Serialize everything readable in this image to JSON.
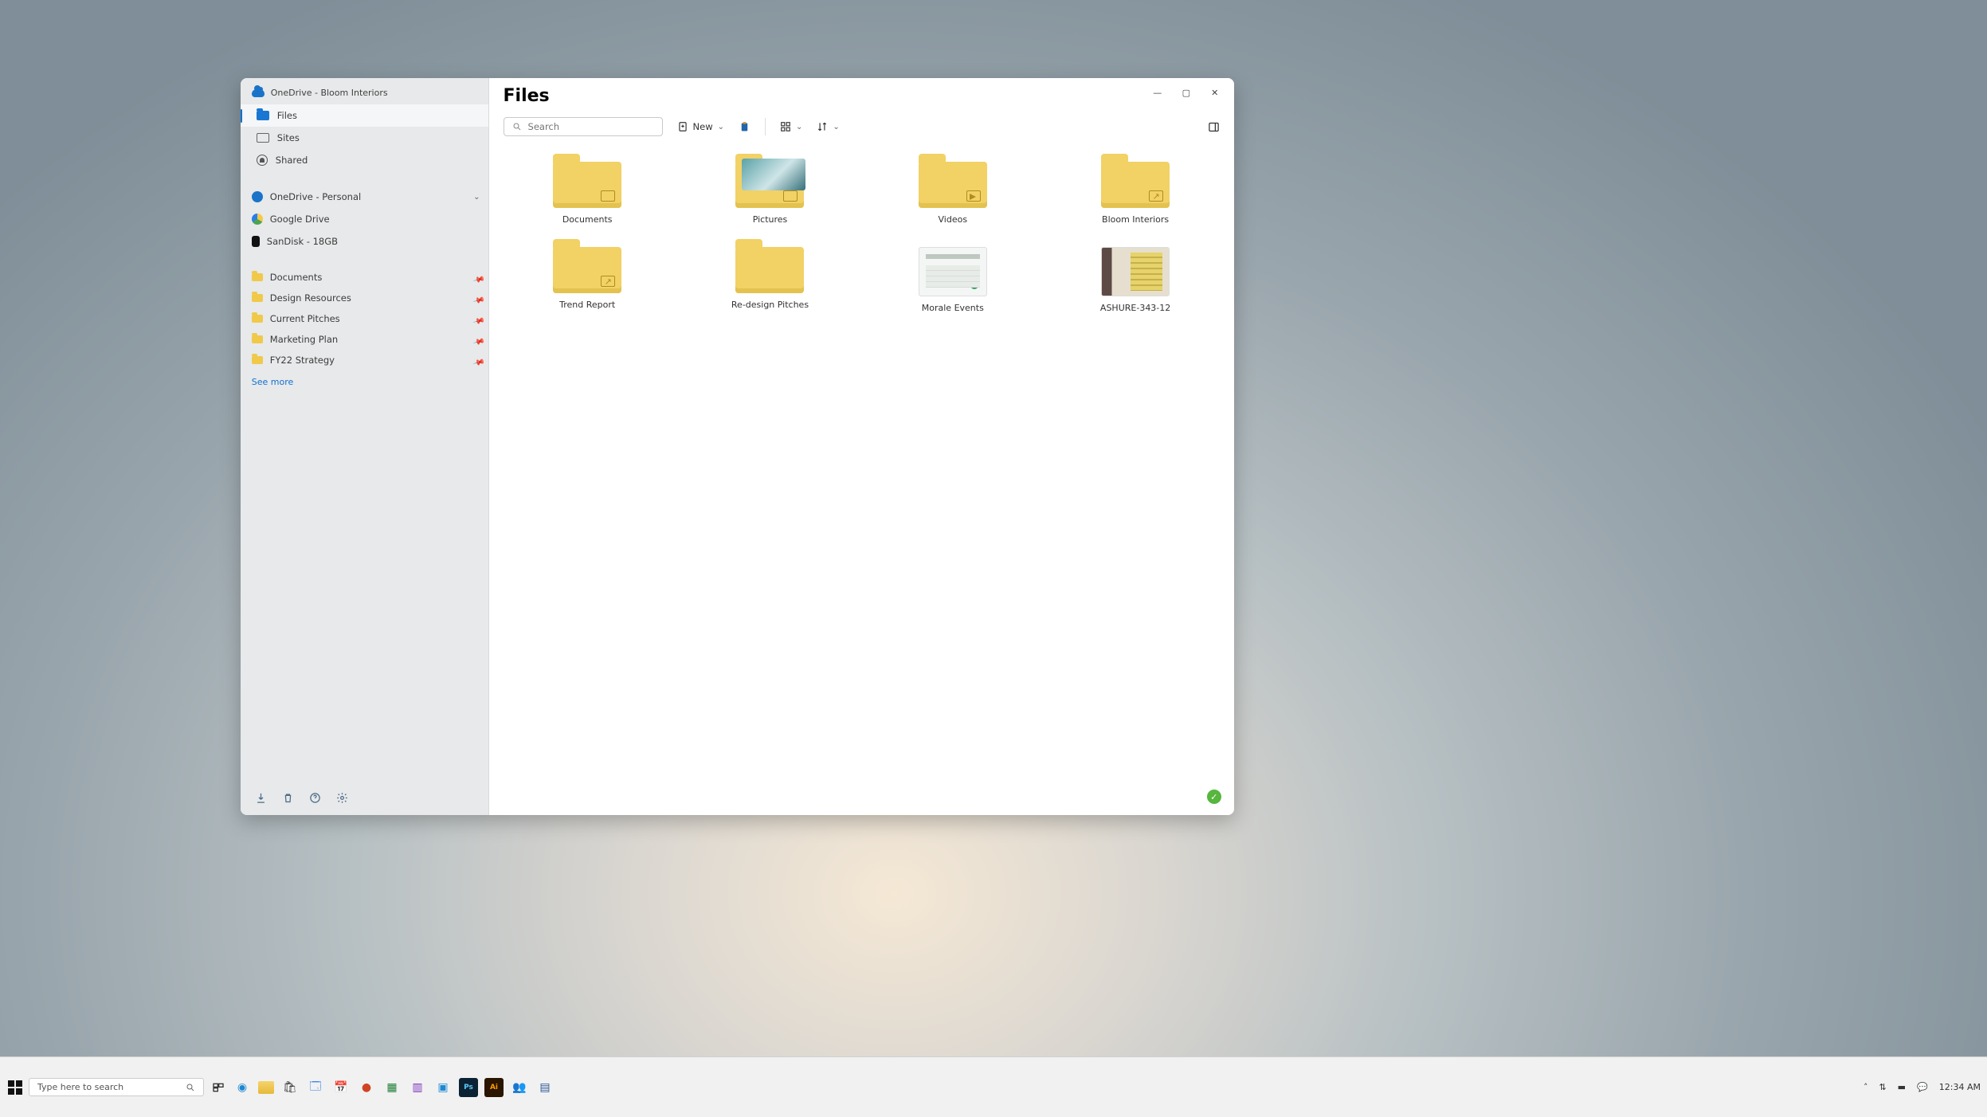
{
  "window": {
    "account_title": "OneDrive - Bloom Interiors",
    "titlebar": {
      "min": "—",
      "max": "▢",
      "close": "✕"
    }
  },
  "sidebar": {
    "nav": {
      "files": "Files",
      "sites": "Sites",
      "shared": "Shared"
    },
    "accounts": [
      {
        "name": "OneDrive - Personal",
        "kind": "od",
        "expandable": true
      },
      {
        "name": "Google Drive",
        "kind": "gd",
        "expandable": false
      },
      {
        "name": "SanDisk - 18GB",
        "kind": "sd",
        "expandable": false
      }
    ],
    "pinned": [
      {
        "name": "Documents"
      },
      {
        "name": "Design Resources"
      },
      {
        "name": "Current Pitches"
      },
      {
        "name": "Marketing Plan"
      },
      {
        "name": "FY22 Strategy"
      }
    ],
    "see_more": "See more"
  },
  "main": {
    "title": "Files",
    "search_placeholder": "Search",
    "new_label": "New",
    "items": {
      "documents": "Documents",
      "pictures": "Pictures",
      "videos": "Videos",
      "bloom": "Bloom Interiors",
      "trend": "Trend Report",
      "redesign": "Re-design Pitches",
      "morale": "Morale Events",
      "photo": "ASHURE-343-12"
    }
  },
  "taskbar": {
    "search_placeholder": "Type here to search",
    "clock": "12:34 AM"
  },
  "colors": {
    "accent": "#1270d0",
    "folder": "#f2d165",
    "sync_ok": "#56b63e"
  }
}
